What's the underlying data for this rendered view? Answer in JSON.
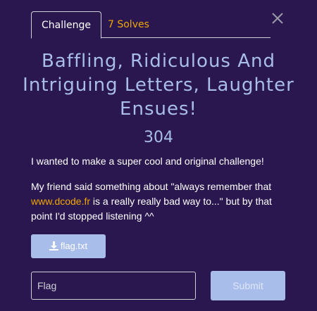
{
  "tabs": {
    "challenge": "Challenge",
    "solves": "7 Solves"
  },
  "challenge": {
    "title": "Baffling, Ridiculous And Intriguing Letters, Laughter Ensues!",
    "points": "304",
    "description_line1": "I wanted to make a super cool and original challenge!",
    "description_pre": "My friend said something about \"always remember that ",
    "description_link": "www.dcode.fr",
    "description_post": " is a really really bad way to...\" but by that point I'd stopped listening ^^"
  },
  "file": {
    "label": "flag.txt",
    "icon": "download-icon"
  },
  "form": {
    "flag_placeholder": "Flag",
    "flag_value": "",
    "submit_label": "Submit"
  },
  "colors": {
    "background": "#2a1750",
    "accent": "#a8bdea",
    "link": "#f0a800",
    "border": "#cfcfd6"
  },
  "icons": {
    "close": "close-icon"
  }
}
